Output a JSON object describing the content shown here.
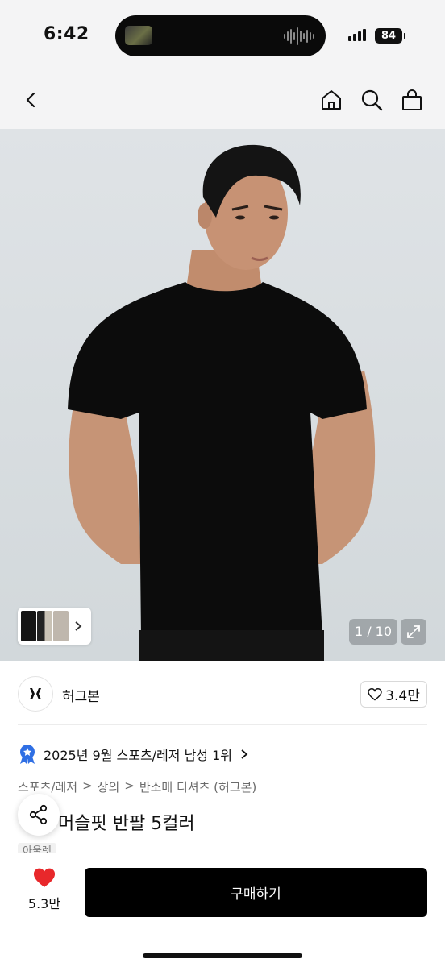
{
  "status_bar": {
    "time": "6:42",
    "battery": "84"
  },
  "nav": {
    "icons": [
      "back-icon",
      "home-icon",
      "search-icon",
      "bag-icon"
    ]
  },
  "hero": {
    "page_indicator": "1 / 10",
    "icons": [
      "chevron-right-icon",
      "expand-icon"
    ]
  },
  "brand": {
    "name": "허그본",
    "likes": "3.4만"
  },
  "ranking": {
    "text": "2025년 9월 스포츠/레저 남성 1위",
    "icon": "award-badge-icon"
  },
  "breadcrumb": {
    "items": [
      "스포츠/레저",
      "상의",
      "반소매 티셔츠 (허그본)"
    ],
    "separator": ">"
  },
  "product": {
    "title": "머슬핏 반팔 5컬러",
    "tag": "아울렛"
  },
  "bottom_bar": {
    "wish_count": "5.3만",
    "buy_label": "구매하기"
  },
  "colors": {
    "accent": "#000000",
    "heart": "#e8282b",
    "badge": "#2f6fe4"
  }
}
